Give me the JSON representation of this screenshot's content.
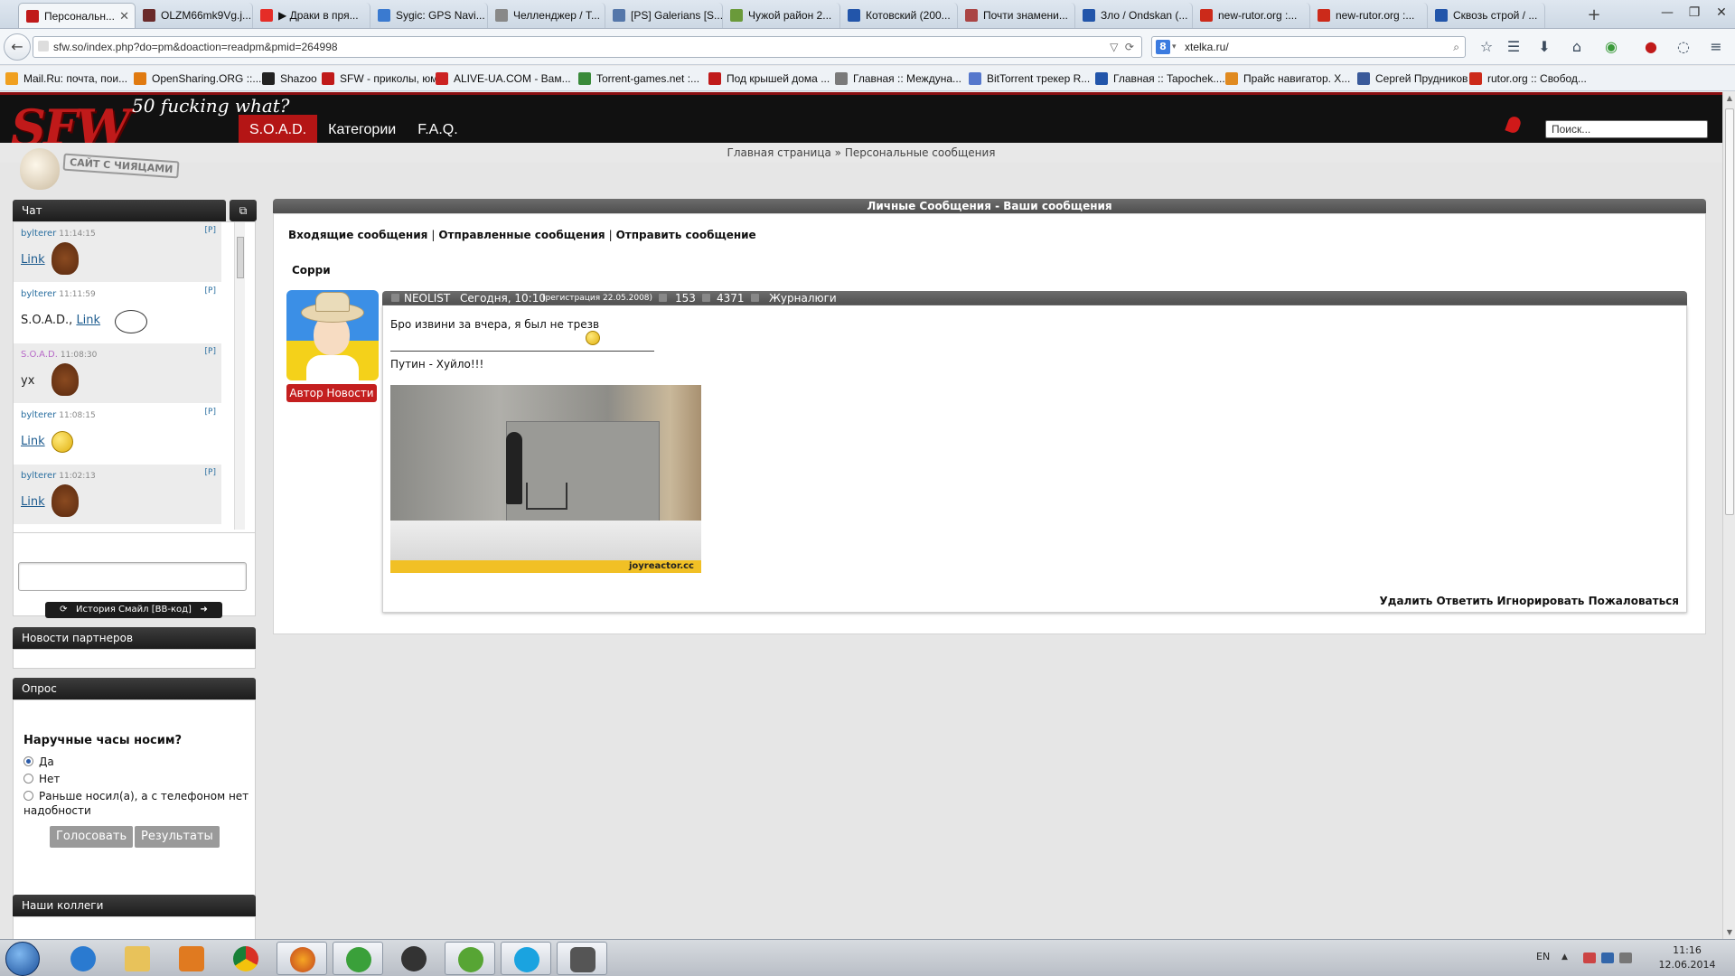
{
  "browser": {
    "tabs": [
      {
        "label": "Персональн...",
        "color": "#c01a1a"
      },
      {
        "label": "OLZM66mk9Vg.j...",
        "color": "#6a2a2a"
      },
      {
        "label": "▶ Драки в пря...",
        "color": "#e52d27"
      },
      {
        "label": "Sygic: GPS Navi...",
        "color": "#3a7ad0"
      },
      {
        "label": "Челленджер / Т...",
        "color": "#888888"
      },
      {
        "label": "[PS] Galerians [S...",
        "color": "#5577aa"
      },
      {
        "label": "Чужой район 2...",
        "color": "#6a9a3a"
      },
      {
        "label": "Котовский (200...",
        "color": "#2255aa"
      },
      {
        "label": "Почти знамени...",
        "color": "#aa4444"
      },
      {
        "label": "Зло / Ondskan (...",
        "color": "#2255aa"
      },
      {
        "label": "new-rutor.org :...",
        "color": "#cc2a1a"
      },
      {
        "label": "new-rutor.org :...",
        "color": "#cc2a1a"
      },
      {
        "label": "Сквозь строй / ...",
        "color": "#2255aa"
      }
    ],
    "new_tab": "+",
    "url": "sfw.so/index.php?do=pm&doaction=readpm&pmid=264998",
    "search_value": "xtelka.ru/",
    "search_engine_letter": "8",
    "bookmarks": [
      {
        "label": "Mail.Ru: почта, пои...",
        "color": "#f0a020"
      },
      {
        "label": "OpenSharing.ORG ::...",
        "color": "#e07a10"
      },
      {
        "label": "Shazoo",
        "color": "#222222"
      },
      {
        "label": "SFW - приколы, юм...",
        "color": "#c01a1a"
      },
      {
        "label": "ALIVE-UA.COM - Вам...",
        "color": "#cc2222"
      },
      {
        "label": "Torrent-games.net :...",
        "color": "#3a8a3a"
      },
      {
        "label": "Под крышей дома ...",
        "color": "#c01a1a"
      },
      {
        "label": "Главная :: Междуна...",
        "color": "#7a7a7a"
      },
      {
        "label": "BitTorrent трекер R...",
        "color": "#5577cc"
      },
      {
        "label": "Главная :: Tapochek....",
        "color": "#2255aa"
      },
      {
        "label": "Прайс навигатор. Х...",
        "color": "#e08a20"
      },
      {
        "label": "Сергей Прудников",
        "color": "#3a5a9a"
      },
      {
        "label": "rutor.org :: Свобод...",
        "color": "#cc2a1a"
      }
    ]
  },
  "site": {
    "logo": "SFW",
    "tagline": "50 fucking what?",
    "stamp": "САЙТ С ЧИЯЦАМИ",
    "menu": [
      "S.O.A.D.",
      "Категории",
      "F.A.Q."
    ],
    "search_placeholder": "Поиск...",
    "breadcrumb": "Главная страница » Персональные сообщения"
  },
  "chat": {
    "title": "Чат",
    "messages": [
      {
        "user": "bylterer",
        "time": "11:14:15",
        "p": "[P]",
        "text": "Link",
        "user_is_soad": false
      },
      {
        "user": "bylterer",
        "time": "11:11:59",
        "p": "[P]",
        "text_prefix": "S.O.A.D., ",
        "text": "Link",
        "user_is_soad": false
      },
      {
        "user": "S.O.A.D.",
        "time": "11:08:30",
        "p": "[P]",
        "text": "ух",
        "user_is_soad": true
      },
      {
        "user": "bylterer",
        "time": "11:08:15",
        "p": "[P]",
        "text": "Link",
        "user_is_soad": false
      },
      {
        "user": "bylterer",
        "time": "11:02:13",
        "p": "[P]",
        "text": "Link",
        "user_is_soad": false
      }
    ],
    "tools": "История  Смайл  [BB-код]"
  },
  "partners": {
    "title": "Новости партнеров"
  },
  "poll": {
    "title": "Опрос",
    "question": "Наручные часы носим?",
    "options": [
      "Да",
      "Нет",
      "Раньше носил(а), а с телефоном нет надобности"
    ],
    "selected": 0,
    "vote": "Голосовать",
    "results": "Результаты"
  },
  "colleagues": {
    "title": "Наши коллеги"
  },
  "pm": {
    "header": "Личные Сообщения - Ваши сообщения",
    "links": [
      "Входящие сообщения",
      "Отправленные сообщения",
      "Отправить сообщение"
    ],
    "subject": "Сорри",
    "author": "NEOLIST",
    "date": "Сегодня, 10:10",
    "reg": "(регистрация 22.05.2008)",
    "news_count": "153",
    "comments_count": "4371",
    "group": "Журналюги",
    "badge": "Автор Новости",
    "text1": "Бро извини за вчера, я был не трезв",
    "text2": "Путин - Хуйло!!!",
    "gif_source": "joyreactor.cc",
    "actions": [
      "Удалить",
      "Ответить",
      "Игнорировать",
      "Пожаловаться"
    ]
  },
  "taskbar": {
    "lang": "EN",
    "time": "11:16",
    "date": "12.06.2014"
  }
}
